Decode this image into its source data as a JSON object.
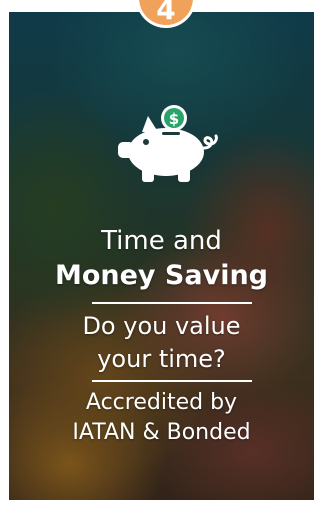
{
  "badge": {
    "number": "4"
  },
  "icon": {
    "name": "piggy-bank-dollar-icon"
  },
  "heading": {
    "line1": "Time and",
    "line2": "Money Saving"
  },
  "question": {
    "line1": "Do you value",
    "line2": "your time?"
  },
  "accreditation": {
    "line1": "Accredited by",
    "line2": "IATAN & Bonded"
  },
  "colors": {
    "badge": "#f0a25a",
    "text": "#ffffff",
    "dollar_coin": "#2aa36a"
  }
}
